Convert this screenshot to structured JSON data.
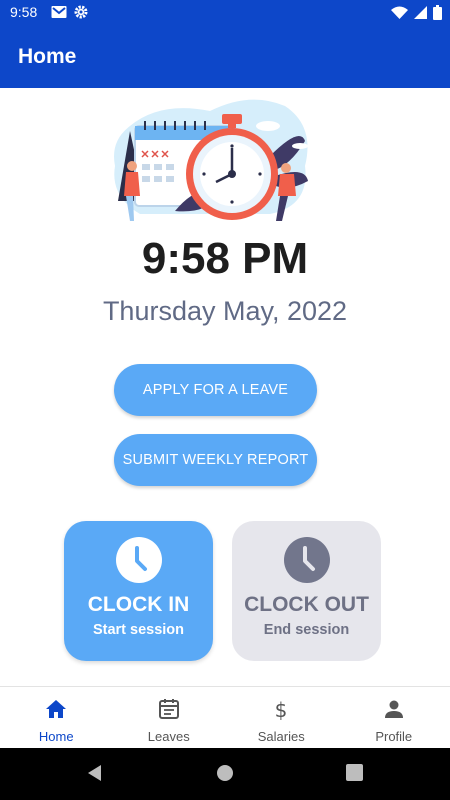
{
  "status_bar": {
    "time": "9:58",
    "icons_left": [
      "gmail-icon",
      "settings-icon"
    ],
    "icons_right": [
      "wifi-icon",
      "signal-icon",
      "battery-icon"
    ]
  },
  "app_bar": {
    "title": "Home"
  },
  "illustration": {
    "name": "clock-calendar-illustration"
  },
  "clock": {
    "time": "9:58 PM",
    "date": "Thursday May, 2022"
  },
  "actions": {
    "apply_leave": "APPLY FOR A LEAVE",
    "weekly_report": "SUBMIT WEEKLY REPORT"
  },
  "clock_in": {
    "title": "CLOCK IN",
    "subtitle": "Start session"
  },
  "clock_out": {
    "title": "CLOCK OUT",
    "subtitle": "End session"
  },
  "bottom_nav": {
    "items": [
      {
        "label": "Home",
        "icon": "home-icon",
        "active": true
      },
      {
        "label": "Leaves",
        "icon": "calendar-icon",
        "active": false
      },
      {
        "label": "Salaries",
        "icon": "dollar-icon",
        "active": false
      },
      {
        "label": "Profile",
        "icon": "person-icon",
        "active": false
      }
    ]
  },
  "colors": {
    "primary": "#0d47c9",
    "accent_button": "#5aa9f6",
    "card_inactive": "#e6e6ec",
    "date_text": "#606a85"
  },
  "system_nav": [
    "back-button",
    "home-button",
    "recents-button"
  ]
}
